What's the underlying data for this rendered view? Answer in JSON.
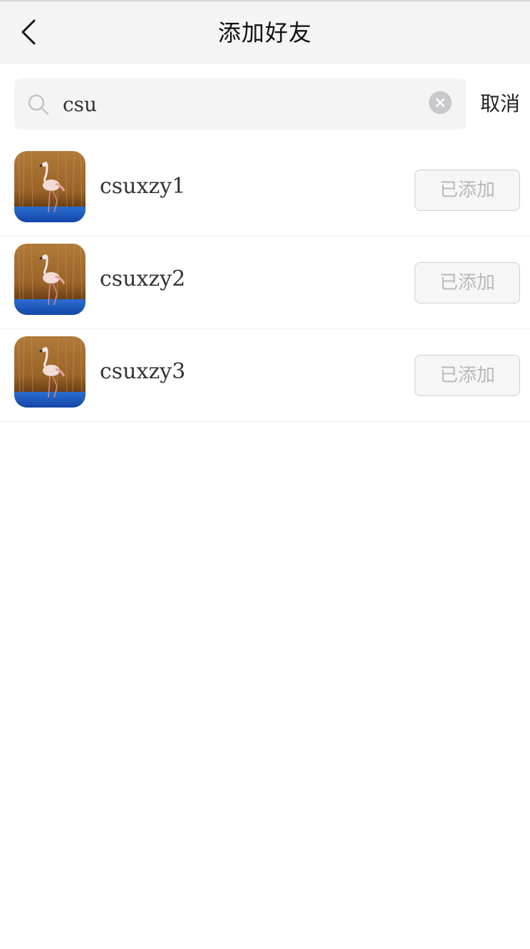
{
  "header": {
    "title": "添加好友",
    "back_icon": "chevron-left-icon"
  },
  "search": {
    "value": "csu",
    "placeholder": "",
    "search_icon": "search-icon",
    "clear_icon": "clear-circle-icon",
    "cancel_label": "取消"
  },
  "results": [
    {
      "username": "csuxzy1",
      "button_label": "已添加",
      "avatar": "flamingo-avatar"
    },
    {
      "username": "csuxzy2",
      "button_label": "已添加",
      "avatar": "flamingo-avatar"
    },
    {
      "username": "csuxzy3",
      "button_label": "已添加",
      "avatar": "flamingo-avatar"
    }
  ],
  "colors": {
    "header_bg": "#f4f4f4",
    "search_bg": "#f4f4f4",
    "added_text": "#b8b8b8"
  }
}
